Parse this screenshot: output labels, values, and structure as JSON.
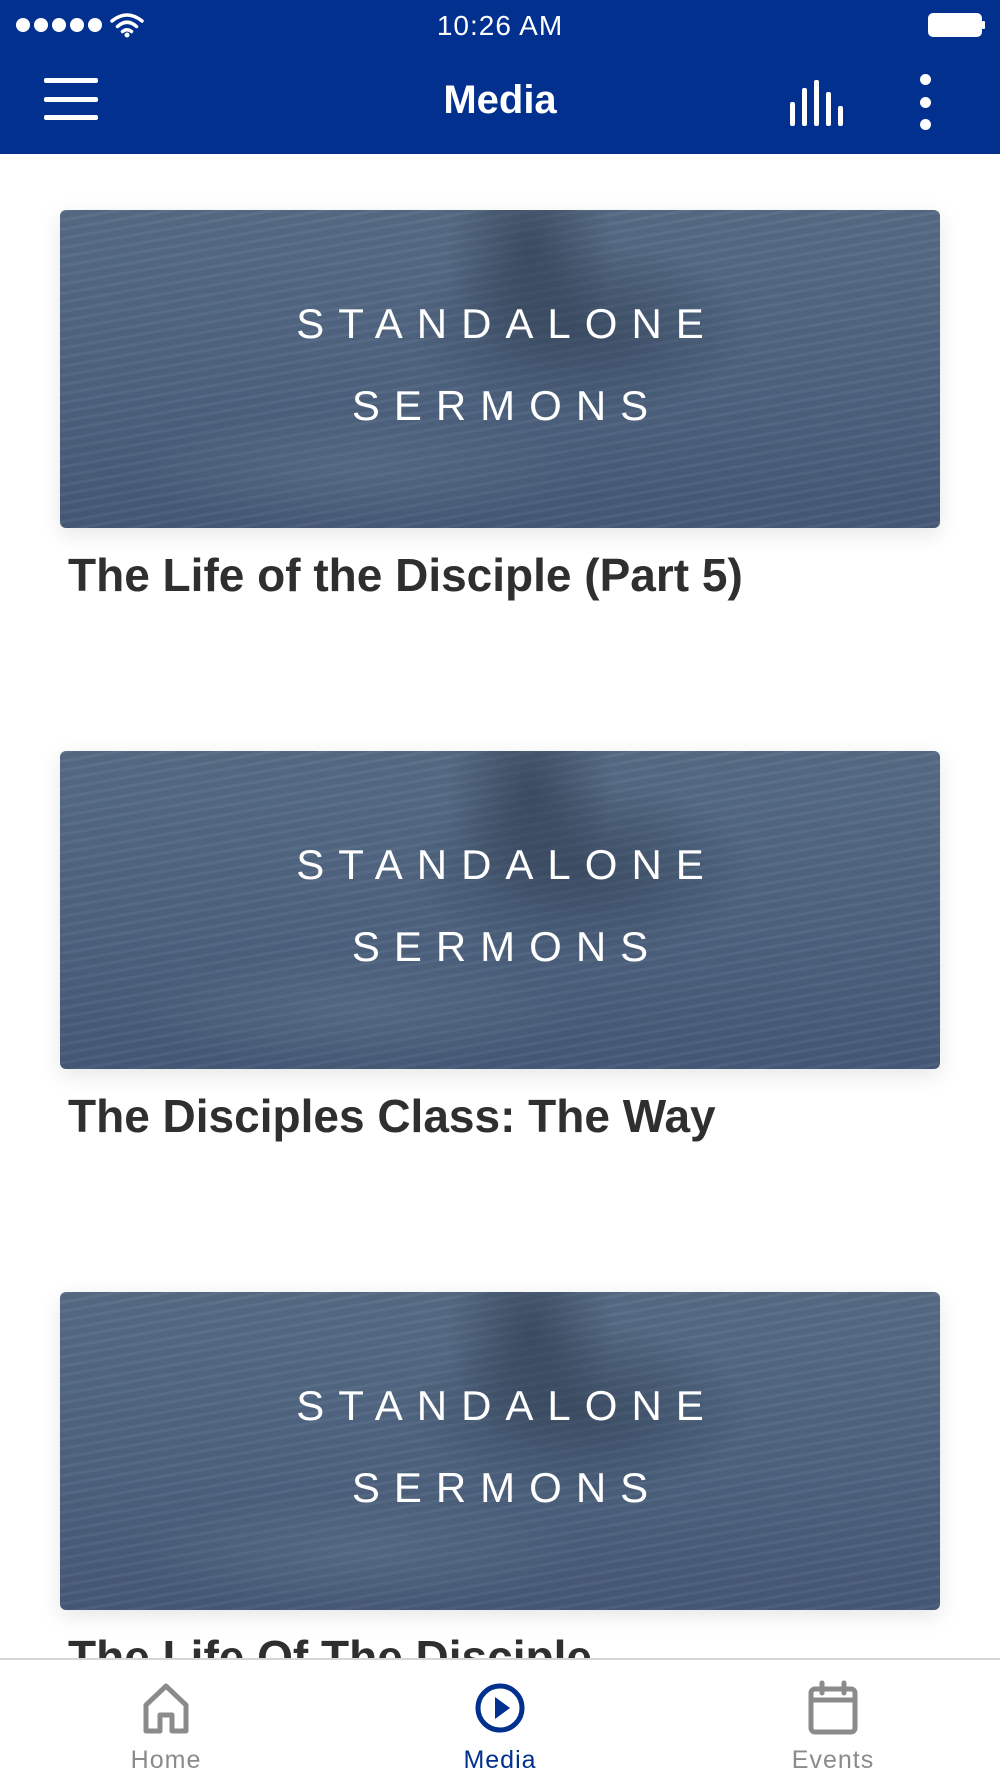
{
  "status_bar": {
    "time": "10:26 AM"
  },
  "header": {
    "title": "Media",
    "left_icon": "hamburger-menu-icon",
    "right_icons": [
      "audio-bars-icon",
      "more-vertical-icon"
    ],
    "background_color": "#02308e"
  },
  "media": {
    "items": [
      {
        "image_line1": "STANDALONE",
        "image_line2": "SERMONS",
        "title": "The Life of the Disciple (Part 5)"
      },
      {
        "image_line1": "STANDALONE",
        "image_line2": "SERMONS",
        "title": "The Disciples Class: The Way"
      },
      {
        "image_line1": "STANDALONE",
        "image_line2": "SERMONS",
        "title": "The Life Of The Disciple"
      }
    ]
  },
  "bottom_nav": {
    "items": [
      {
        "label": "Home",
        "icon": "home-icon",
        "active": false
      },
      {
        "label": "Media",
        "icon": "play-circle-icon",
        "active": true
      },
      {
        "label": "Events",
        "icon": "calendar-icon",
        "active": false
      }
    ],
    "active_color": "#02308e",
    "inactive_color": "#8b8b8b"
  }
}
